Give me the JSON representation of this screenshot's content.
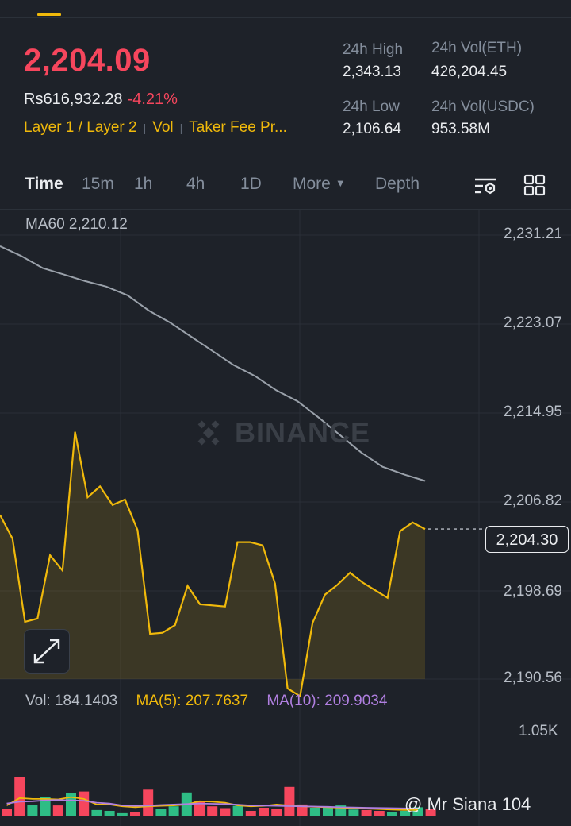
{
  "header": {
    "last_price": "2,204.09",
    "fiat_price": "Rs616,932.28",
    "change_pct": "-4.21%",
    "tags": [
      "Layer 1 / Layer 2",
      "Vol",
      "Taker Fee Pr..."
    ],
    "stats": {
      "high_label": "24h High",
      "high_value": "2,343.13",
      "vol_base_label": "24h Vol(ETH)",
      "vol_base_value": "426,204.45",
      "low_label": "24h Low",
      "low_value": "2,106.64",
      "vol_quote_label": "24h Vol(USDC)",
      "vol_quote_value": "953.58M"
    }
  },
  "timebar": {
    "items": [
      "Time",
      "15m",
      "1h",
      "4h",
      "1D",
      "More",
      "Depth"
    ],
    "active": "Time"
  },
  "price_chart": {
    "ma60_label": "MA60 2,210.12",
    "y_axis": [
      "2,231.21",
      "2,223.07",
      "2,214.95",
      "2,206.82",
      "2,198.69",
      "2,190.56"
    ],
    "current_price_tag": "2,204.30",
    "watermark": "BINANCE"
  },
  "volume_panel": {
    "vol": "Vol: 184.1403",
    "ma5": "MA(5): 207.7637",
    "ma10": "MA(10): 209.9034",
    "y_max": "1.05K"
  },
  "credit": "@ Mr Siana 104",
  "colors": {
    "background": "#1e2229",
    "down": "#f6465d",
    "up": "#2ebd85",
    "accent": "#f0b90b",
    "ma10": "#b07fe0"
  },
  "icons": [
    "chart-settings-icon",
    "grid-layout-icon",
    "expand-icon",
    "binance-logo-icon"
  ],
  "chart_data": {
    "type": "line",
    "series": [
      {
        "name": "Price",
        "values": [
          2205.6,
          2203.4,
          2195.8,
          2196.1,
          2201.9,
          2200.5,
          2213.2,
          2207.2,
          2208.2,
          2206.5,
          2207.0,
          2204.2,
          2194.7,
          2194.8,
          2195.5,
          2199.1,
          2197.4,
          2197.3,
          2197.2,
          2203.1,
          2203.1,
          2202.8,
          2199.3,
          2189.7,
          2189.0,
          2195.7,
          2198.3,
          2199.2,
          2200.3,
          2199.4,
          2198.7,
          2198.0,
          2204.1,
          2204.9,
          2204.3
        ]
      },
      {
        "name": "MA60",
        "values": [
          2230.2,
          2229.3,
          2228.2,
          2227.6,
          2227.0,
          2226.5,
          2225.7,
          2224.3,
          2223.2,
          2221.9,
          2220.6,
          2219.3,
          2218.3,
          2217.0,
          2216.0,
          2214.5,
          2212.9,
          2211.3,
          2210.0,
          2209.3,
          2208.7
        ]
      }
    ],
    "volume_series": [
      {
        "dir": "down",
        "v": 80
      },
      {
        "dir": "down",
        "v": 430
      },
      {
        "dir": "up",
        "v": 128
      },
      {
        "dir": "up",
        "v": 210
      },
      {
        "dir": "down",
        "v": 120
      },
      {
        "dir": "up",
        "v": 250
      },
      {
        "dir": "down",
        "v": 270
      },
      {
        "dir": "up",
        "v": 70
      },
      {
        "dir": "up",
        "v": 60
      },
      {
        "dir": "up",
        "v": 35
      },
      {
        "dir": "down",
        "v": 45
      },
      {
        "dir": "down",
        "v": 290
      },
      {
        "dir": "up",
        "v": 80
      },
      {
        "dir": "up",
        "v": 110
      },
      {
        "dir": "up",
        "v": 260
      },
      {
        "dir": "down",
        "v": 170
      },
      {
        "dir": "down",
        "v": 110
      },
      {
        "dir": "down",
        "v": 90
      },
      {
        "dir": "up",
        "v": 115
      },
      {
        "dir": "down",
        "v": 60
      },
      {
        "dir": "down",
        "v": 95
      },
      {
        "dir": "down",
        "v": 80
      },
      {
        "dir": "down",
        "v": 320
      },
      {
        "dir": "down",
        "v": 130
      },
      {
        "dir": "up",
        "v": 95
      },
      {
        "dir": "up",
        "v": 95
      },
      {
        "dir": "up",
        "v": 120
      },
      {
        "dir": "up",
        "v": 75
      },
      {
        "dir": "down",
        "v": 70
      },
      {
        "dir": "down",
        "v": 60
      },
      {
        "dir": "up",
        "v": 50
      },
      {
        "dir": "up",
        "v": 60
      },
      {
        "dir": "up",
        "v": 100
      },
      {
        "dir": "down",
        "v": 80
      }
    ],
    "volume_ma5": [
      120,
      200,
      190,
      190,
      185,
      210,
      190,
      130,
      130,
      110,
      100,
      110,
      115,
      120,
      130,
      165,
      160,
      150,
      120,
      110,
      115,
      130,
      120,
      110,
      105,
      100,
      95,
      90,
      85,
      80,
      75,
      70,
      70
    ],
    "volume_ma10": [
      140,
      160,
      165,
      175,
      180,
      175,
      170,
      150,
      140,
      120,
      115,
      118,
      125,
      130,
      135,
      140,
      138,
      135,
      128,
      120,
      118,
      115,
      112,
      110,
      108,
      105,
      100,
      98,
      95,
      92,
      90,
      88,
      86
    ],
    "ylim": [
      2190.56,
      2231.21
    ],
    "volume_ylim": [
      0,
      1050
    ],
    "grid": true
  }
}
